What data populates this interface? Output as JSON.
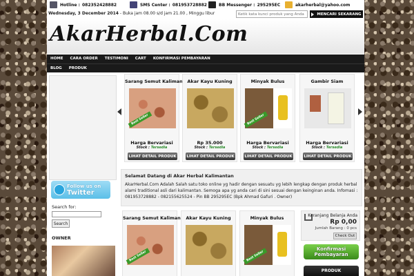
{
  "topbar": {
    "hotline_label": "Hotline :",
    "hotline": "082352428882",
    "sms_label": "SMS Center :",
    "sms": "081953728882",
    "bb_label": "BB Messenger :",
    "bb": "295295EC",
    "email": "akarherbal@yahoo.com",
    "date": "Wednesday, 3 December 2014",
    "hours": " - Buka jam 08.00 s/d jam 21.00 , Minggu libur",
    "search_placeholder": "Ketik kata kunci produk yang Anda",
    "search_button": "MENCARI SEKARANG"
  },
  "header": {
    "logo": "AkarHerbal.Com"
  },
  "nav": {
    "row1": [
      "HOME",
      "CARA ORDER",
      "TESTIMONI",
      "CART",
      "KONFIRMASI PEMBAYARAN"
    ],
    "row2": [
      "BLOG",
      "PRODUK"
    ]
  },
  "slider": {
    "products": [
      {
        "title": "Sarang Semut Kaliman",
        "price": "Harga Bervariasi",
        "badge": "Best Seller"
      },
      {
        "title": "Akar Kayu Kuning",
        "price": "Rp 35.000",
        "badge": ""
      },
      {
        "title": "Minyak Bulus",
        "price": "Harga Bervariasi",
        "badge": "Best Seller"
      },
      {
        "title": "Gambir Siam",
        "price": "Harga Bervariasi",
        "badge": ""
      }
    ],
    "stock_label": "Stock : ",
    "stock_value": "Tersedia",
    "detail_button": "LIHAT DETAIL PRODUK"
  },
  "sidebar": {
    "twitter_small": "Follow us on",
    "twitter_big": "Twitter",
    "search_label": "Search for:",
    "search_button": "Search",
    "owner_title": "OWNER"
  },
  "welcome": {
    "title": "Selamat Datang di Akar Herbal Kalimantan",
    "text": "AkarHerbal.Com Adalah Salah satu toko online yg hadir dengan sesuatu yg lebih lengkap dengan produk herbal alami traditional asli dari kalimantan. Semoga apa yg anda cari di sini sesuai dengan keinginan anda. Infomasi : 081953728882 - 082155625524 - Pin BB 295295EC (Bpk Ahmad Gafuri . Owner)"
  },
  "grid": {
    "products": [
      {
        "title": "Sarang Semut Kaliman"
      },
      {
        "title": "Akar Kayu Kuning"
      },
      {
        "title": "Minyak Bulus"
      }
    ]
  },
  "cart": {
    "title": "Keranjang Belanja Anda",
    "total": "Rp 0,00",
    "count": "Jumlah Barang : 0 pcs",
    "checkout": "Check Out"
  },
  "konfirmasi": {
    "line1": "Konfirmasi",
    "line2": "Pembayaran"
  },
  "produk_banner": "PRODUK"
}
